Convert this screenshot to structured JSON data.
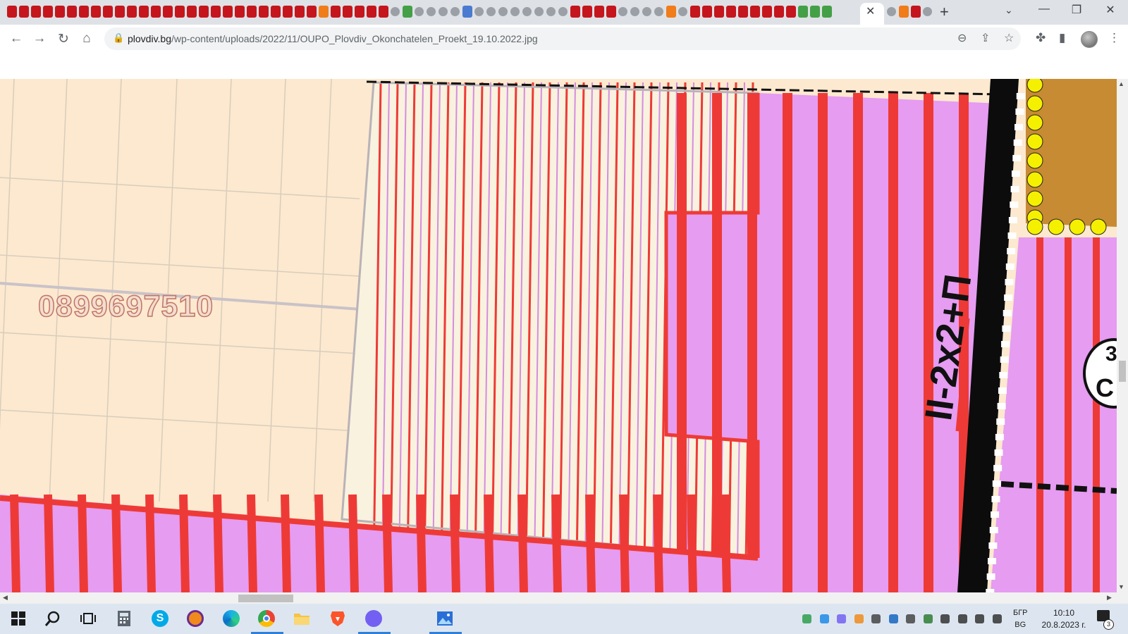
{
  "browser": {
    "url_host": "plovdiv.bg",
    "url_path": "/wp-content/uploads/2022/11/OUPO_Plovdiv_Okonchatelen_Proekt_19.10.2022.jpg",
    "icons": {
      "back": "back-arrow-icon",
      "forward": "forward-arrow-icon",
      "reload": "reload-icon",
      "home": "home-icon",
      "lock": "lock-icon",
      "zoom": "zoom-icon",
      "share": "share-icon",
      "bookmark": "star-icon",
      "extensions": "puzzle-icon",
      "side_panel": "side-panel-icon",
      "menu": "kebab-menu-icon"
    },
    "glyphs": {
      "back": "←",
      "forward": "→",
      "reload": "↻",
      "home": "⌂",
      "lock": "🔒",
      "zoom": "⊖",
      "share": "⇪",
      "bookmark": "☆",
      "extensions": "✤",
      "side_panel": "▮",
      "menu": "⋮",
      "close_tab": "✕",
      "new_tab": "+",
      "tab_list": "⌄",
      "minimize": "—",
      "restore": "❐",
      "close_window": "✕"
    }
  },
  "map": {
    "watermark_phone": "0899697510",
    "road_label": "II-2x2+П",
    "badge_top": "3",
    "badge_bottom": "С",
    "colors": {
      "cream": "#fde9cf",
      "magenta": "#e59cf1",
      "red": "#ee3a36",
      "black": "#0c0c0c",
      "yellow": "#f5f000",
      "brown": "#c78b33",
      "pale_stripes": "#f8f2df"
    }
  },
  "taskbar": {
    "apps": [
      "windows-start",
      "search",
      "task-view",
      "calculator",
      "skype",
      "avast",
      "edge",
      "chrome",
      "file-explorer",
      "brave",
      "viber",
      "photos"
    ],
    "language_top": "БГР",
    "language_bottom": "BG",
    "time": "10:10",
    "date": "20.8.2023 г.",
    "notifications_count": "3"
  }
}
